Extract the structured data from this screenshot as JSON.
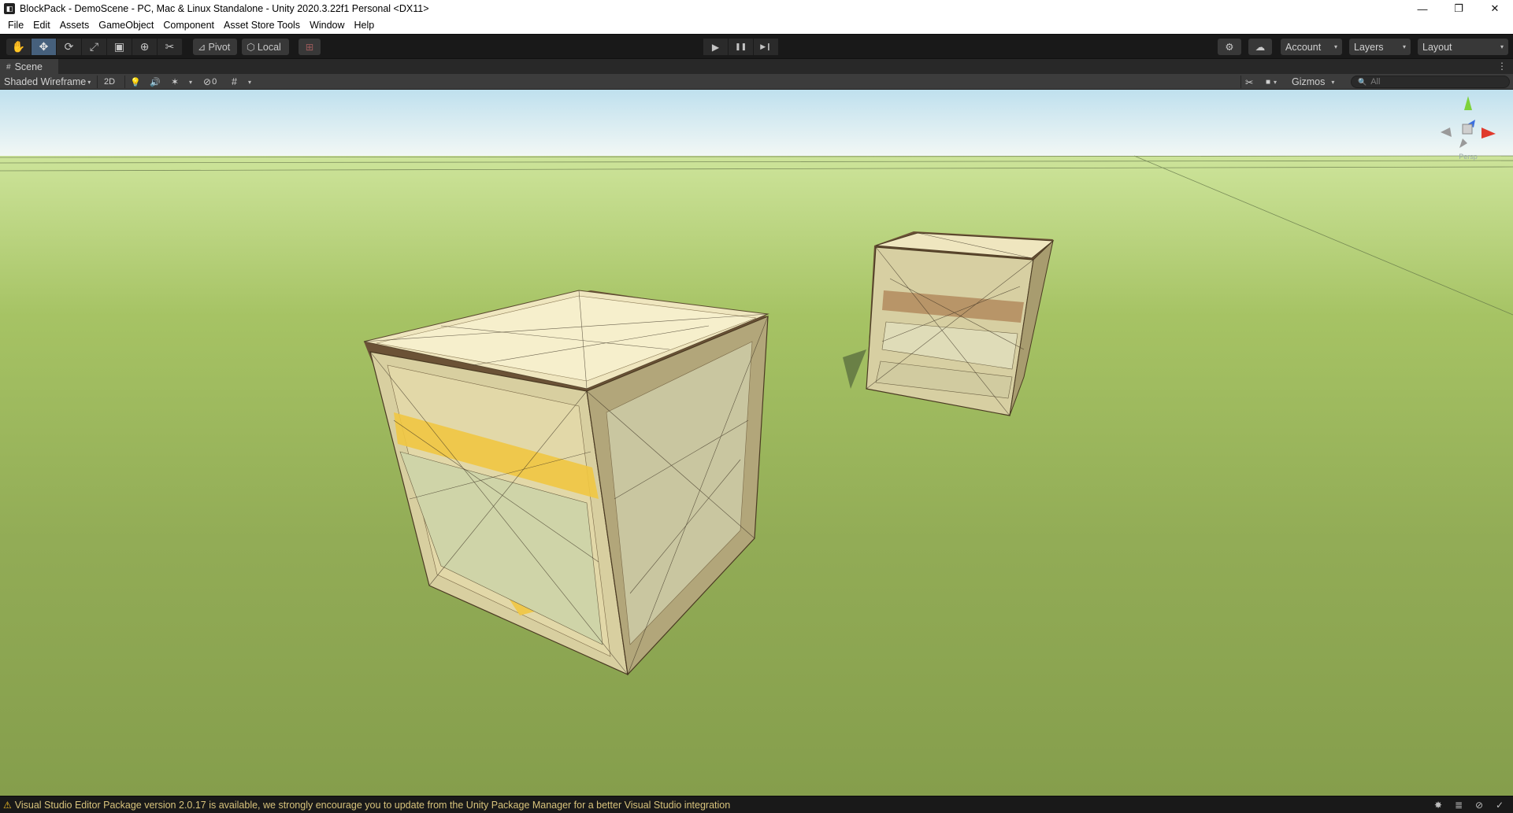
{
  "window": {
    "title": "BlockPack - DemoScene - PC, Mac & Linux Standalone - Unity 2020.3.22f1 Personal <DX11>",
    "app_icon_glyph": "◧",
    "controls": {
      "minimize": "—",
      "restore": "❐",
      "close": "✕"
    }
  },
  "menu": {
    "items": [
      "File",
      "Edit",
      "Assets",
      "GameObject",
      "Component",
      "Asset Store Tools",
      "Window",
      "Help"
    ]
  },
  "toolbar": {
    "tools": [
      {
        "name": "hand-tool",
        "glyph": "✋"
      },
      {
        "name": "move-tool",
        "glyph": "✥"
      },
      {
        "name": "rotate-tool",
        "glyph": "⟳"
      },
      {
        "name": "scale-tool",
        "glyph": "⤢"
      },
      {
        "name": "rect-tool",
        "glyph": "▣"
      },
      {
        "name": "transform-tool",
        "glyph": "⊕"
      },
      {
        "name": "custom-tool",
        "glyph": "✂"
      }
    ],
    "active_tool_index": 1,
    "pivot_label": "Pivot",
    "local_label": "Local",
    "snap_glyph": "⊞",
    "play_glyph": "▶",
    "pause_glyph": "❚❚",
    "step_glyph": "▶❙",
    "collab_glyph": "⚙",
    "cloud_glyph": "☁",
    "account_label": "Account",
    "layers_label": "Layers",
    "layout_label": "Layout",
    "caret": "▾"
  },
  "scene_tab": {
    "icon": "#",
    "label": "Scene",
    "menu_glyph": "⋮"
  },
  "scene_toolbar": {
    "shading_mode": "Shaded Wireframe",
    "two_d_label": "2D",
    "light_glyph": "💡",
    "audio_glyph": "🔊",
    "effects_glyph": "✶",
    "hidden_glyph": "⊘",
    "hidden_count": "0",
    "grid_glyph": "#",
    "tools_glyph": "✂",
    "camera_glyph": "■",
    "gizmos_label": "Gizmos",
    "search_icon": "🔍",
    "search_placeholder": "All",
    "caret": "▾"
  },
  "viewport": {
    "sky_color": "#e3f0f6",
    "ground_color": "#8da654",
    "gizmo_label": "Persp"
  },
  "status": {
    "warning_icon": "⚠",
    "message": "Visual Studio Editor Package version 2.0.17 is available, we strongly encourage you to update from the Unity Package Manager for a better Visual Studio integration",
    "icons": [
      "✸",
      "≣",
      "⊘",
      "✓"
    ]
  }
}
